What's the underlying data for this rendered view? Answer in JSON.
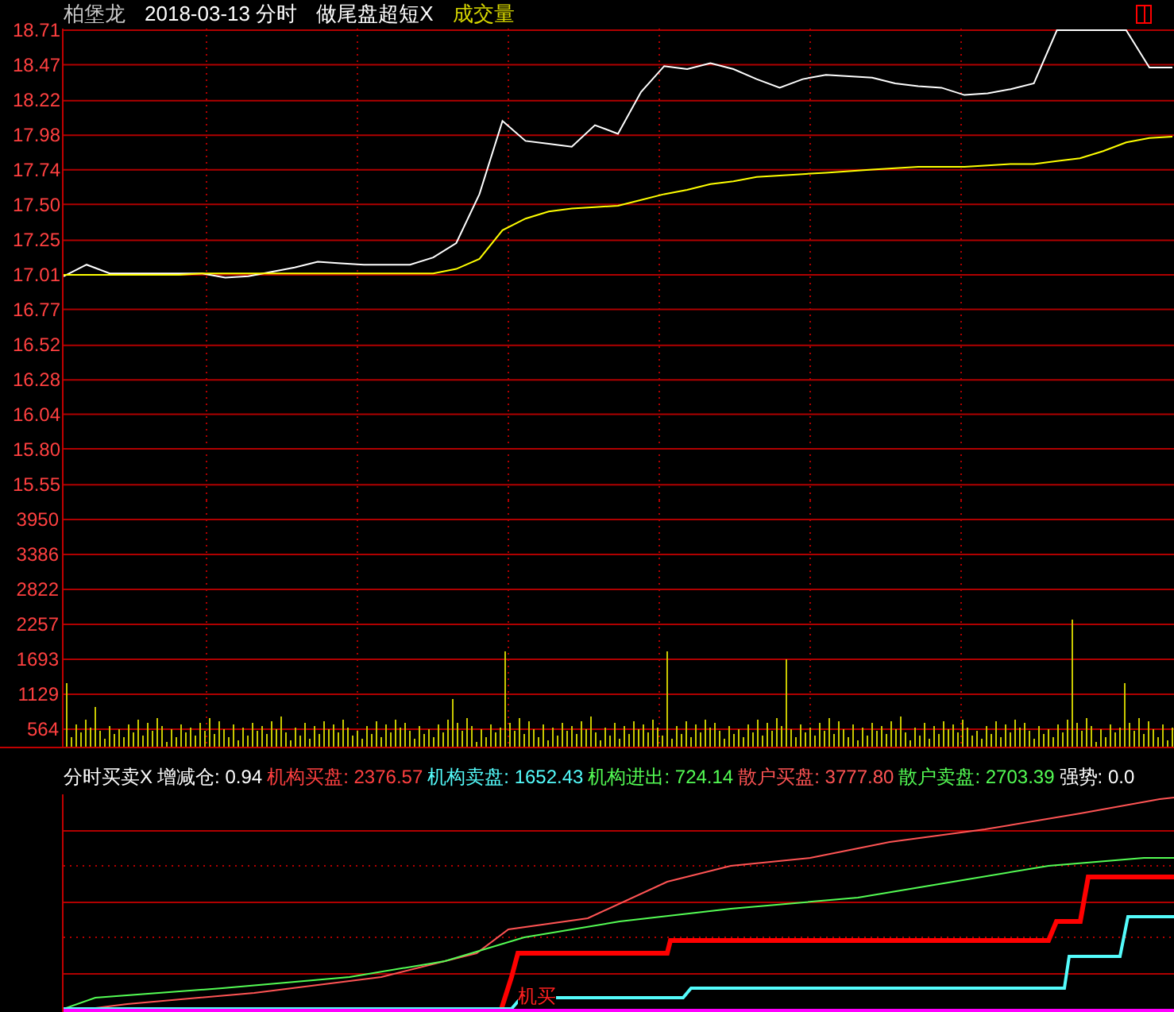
{
  "header": [
    {
      "text": "柏堡龙",
      "color": "#c8c8c8"
    },
    {
      "text": "2018-03-13 分时",
      "color": "#ffffff"
    },
    {
      "text": "做尾盘超短X",
      "color": "#ffffff"
    },
    {
      "text": "成交量",
      "color": "#d8d800"
    }
  ],
  "price_chart": {
    "chart_data": {
      "type": "line",
      "grid": true,
      "ylim": [
        13.73,
        18.71
      ],
      "yticks": [
        {
          "value": 18.71,
          "label": "18.71"
        },
        {
          "value": 18.47,
          "label": "18.47"
        },
        {
          "value": 18.22,
          "label": "18.22"
        },
        {
          "value": 17.98,
          "label": "17.98"
        },
        {
          "value": 17.74,
          "label": "17.74"
        },
        {
          "value": 17.5,
          "label": "17.50"
        },
        {
          "value": 17.25,
          "label": "17.25"
        },
        {
          "value": 17.01,
          "label": "17.01"
        },
        {
          "value": 16.77,
          "label": "16.77"
        },
        {
          "value": 16.52,
          "label": "16.52"
        },
        {
          "value": 16.28,
          "label": "16.28"
        },
        {
          "value": 16.04,
          "label": "16.04"
        },
        {
          "value": 15.8,
          "label": "15.80"
        },
        {
          "value": 15.55,
          "label": "15.55"
        }
      ],
      "categories": [
        null,
        null,
        null,
        null,
        null,
        null,
        null,
        null,
        null,
        null,
        null,
        null,
        null,
        null,
        null,
        null,
        null,
        null,
        null,
        null,
        null,
        null,
        null,
        null,
        null,
        null,
        null,
        null,
        null,
        null,
        null,
        null,
        null,
        null,
        null,
        null,
        null,
        null,
        null,
        null,
        null,
        null,
        null,
        null,
        null,
        null,
        null,
        null,
        null
      ],
      "series": [
        {
          "color": "#ffffff",
          "values": [
            17.0,
            17.08,
            17.02,
            17.02,
            17.02,
            17.02,
            17.02,
            16.99,
            17.0,
            17.03,
            17.06,
            17.1,
            17.09,
            17.08,
            17.08,
            17.08,
            17.13,
            17.23,
            17.57,
            18.08,
            17.94,
            17.92,
            17.9,
            18.05,
            17.99,
            18.28,
            18.46,
            18.44,
            18.48,
            18.44,
            18.37,
            18.31,
            18.37,
            18.4,
            18.39,
            18.38,
            18.34,
            18.32,
            18.31,
            18.26,
            18.27,
            18.3,
            18.34,
            18.71,
            18.71,
            18.71,
            18.71,
            18.45,
            18.45
          ]
        },
        {
          "color": "#ffff00",
          "values": [
            17.01,
            17.01,
            17.01,
            17.01,
            17.01,
            17.01,
            17.02,
            17.02,
            17.02,
            17.02,
            17.02,
            17.02,
            17.02,
            17.02,
            17.02,
            17.02,
            17.02,
            17.05,
            17.12,
            17.32,
            17.4,
            17.45,
            17.47,
            17.48,
            17.49,
            17.53,
            17.57,
            17.6,
            17.64,
            17.66,
            17.69,
            17.7,
            17.71,
            17.72,
            17.73,
            17.74,
            17.75,
            17.76,
            17.76,
            17.76,
            17.77,
            17.78,
            17.78,
            17.8,
            17.82,
            17.87,
            17.93,
            17.96,
            17.97
          ]
        }
      ]
    }
  },
  "volume_axis": [
    "3950",
    "3386",
    "2822",
    "2257",
    "1693",
    "1129",
    "564"
  ],
  "indicator": {
    "title": "分时买卖X",
    "items": [
      {
        "label": "增减仓:",
        "value": "0.94",
        "color": "#ffffff"
      },
      {
        "label": "机构买盘:",
        "value": "2376.57",
        "color": "#ff4040"
      },
      {
        "label": "机构卖盘:",
        "value": "1652.43",
        "color": "#54fcfc"
      },
      {
        "label": "机构进出:",
        "value": "724.14",
        "color": "#54fc54"
      },
      {
        "label": "散户买盘:",
        "value": "3777.80",
        "color": "#ff5454"
      },
      {
        "label": "散户卖盘:",
        "value": "2703.39",
        "color": "#54fc54"
      },
      {
        "label": "强势:",
        "value": "0.0",
        "color": "#ffffff"
      }
    ],
    "marker": "机买"
  }
}
